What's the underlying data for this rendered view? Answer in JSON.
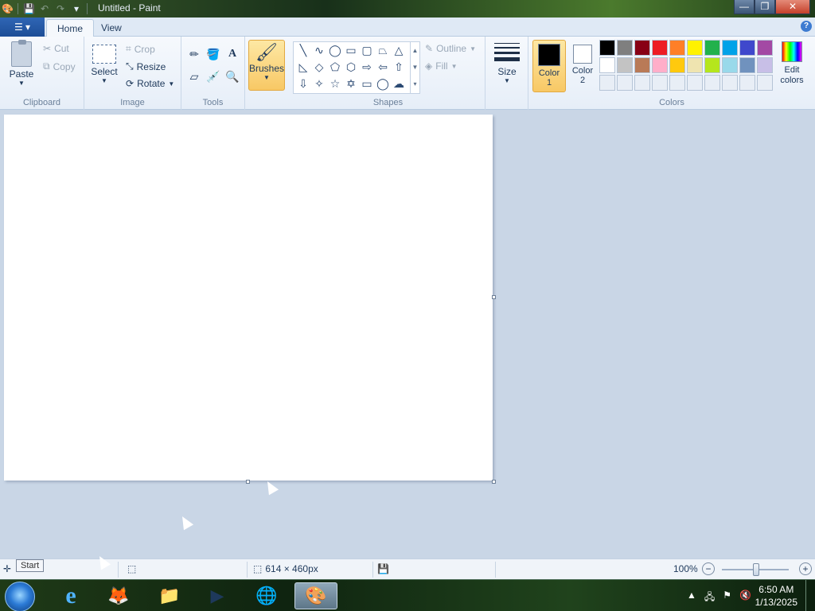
{
  "window": {
    "title": "Untitled - Paint",
    "controls": {
      "minimize": "—",
      "maximize": "❐",
      "close": "✕"
    }
  },
  "quick_access": [
    "save-icon",
    "undo-icon",
    "redo-icon",
    "customize-icon"
  ],
  "tabs": {
    "home": "Home",
    "view": "View"
  },
  "ribbon": {
    "clipboard": {
      "label": "Clipboard",
      "paste": "Paste",
      "cut": "Cut",
      "copy": "Copy"
    },
    "image": {
      "label": "Image",
      "select": "Select",
      "crop": "Crop",
      "resize": "Resize",
      "rotate": "Rotate"
    },
    "tools": {
      "label": "Tools"
    },
    "brushes": {
      "label": "Brushes"
    },
    "shapes": {
      "label": "Shapes",
      "outline": "Outline",
      "fill": "Fill"
    },
    "size": {
      "label": "Size"
    },
    "colors": {
      "label": "Colors",
      "color1": "Color 1",
      "color2": "Color 2",
      "edit": "Edit colors",
      "color1_value": "#000000",
      "color2_value": "#ffffff",
      "palette_row1": [
        "#000000",
        "#7f7f7f",
        "#880015",
        "#ed1c24",
        "#ff7f27",
        "#fff200",
        "#22b14c",
        "#00a2e8",
        "#3f48cc",
        "#a349a4"
      ],
      "palette_row2": [
        "#ffffff",
        "#c3c3c3",
        "#b97a57",
        "#ffaec9",
        "#ffc90e",
        "#efe4b0",
        "#b5e61d",
        "#99d9ea",
        "#7092be",
        "#c8bfe7"
      ]
    }
  },
  "status": {
    "canvas_size": "614 × 460px",
    "zoom": "100%",
    "tooltip": "Start"
  },
  "taskbar": {
    "time": "6:50 AM",
    "date": "1/13/2025"
  }
}
